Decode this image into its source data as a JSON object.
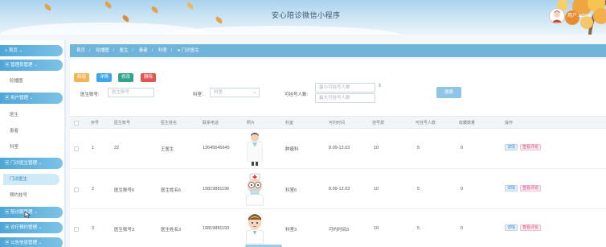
{
  "header": {
    "title": "安心陪诊微信小程序",
    "user": "用户 admin"
  },
  "sidebar": {
    "items": [
      {
        "label": "首页"
      },
      {
        "label": "管理员管理"
      },
      {
        "label": "轮播图"
      },
      {
        "label": "用户管理"
      },
      {
        "label": "医生"
      },
      {
        "label": "患者"
      },
      {
        "label": "科室"
      },
      {
        "label": "门诊医生管理"
      },
      {
        "label": "门诊医生"
      },
      {
        "label": "预约挂号"
      },
      {
        "label": "陪诊服管理"
      },
      {
        "label": "诊疗预约管理"
      },
      {
        "label": "公告信息管理"
      }
    ]
  },
  "breadcrumb": [
    "首页",
    "轮播图",
    "医生",
    "患者",
    "科室",
    "门诊医生"
  ],
  "toolbar": {
    "add": "新增",
    "detail": "详情",
    "edit": "修改",
    "delete": "删除"
  },
  "filters": {
    "doctor_no_label": "医生账号:",
    "doctor_no_placeholder": "医生账号",
    "dept_label": "科室:",
    "dept_placeholder": "科室",
    "quota_label": "可挂号人数:",
    "quota_min_placeholder": "最小可挂号人数",
    "quota_max_placeholder": "最大可挂号人数",
    "search": "搜索"
  },
  "table": {
    "columns": [
      "序号",
      "医生账号",
      "医生姓名",
      "联系电话",
      "照片",
      "科室",
      "可约时间",
      "挂号费",
      "可挂号人数",
      "收藏数量",
      "操作"
    ],
    "rows": [
      {
        "index": "1",
        "doctor_no": "22",
        "name": "王医生",
        "phone": "13645645645",
        "dept": "肿瘤科",
        "time": "8.09-12.03",
        "fee": "10",
        "quota": "5",
        "fav": "0"
      },
      {
        "index": "2",
        "doctor_no": "医生账号6",
        "name": "医生姓名6",
        "phone": "19819881196",
        "dept": "科室6",
        "time": "8.09-12.03",
        "fee": "10",
        "quota": "5",
        "fav": "0"
      },
      {
        "index": "3",
        "doctor_no": "医生账号3",
        "name": "医生姓名3",
        "phone": "19819881193",
        "dept": "科室3",
        "time": "可约时间3",
        "fee": "10",
        "quota": "5",
        "fav": "0"
      }
    ],
    "actions": {
      "detail": "详情",
      "review": "查看评论"
    }
  }
}
